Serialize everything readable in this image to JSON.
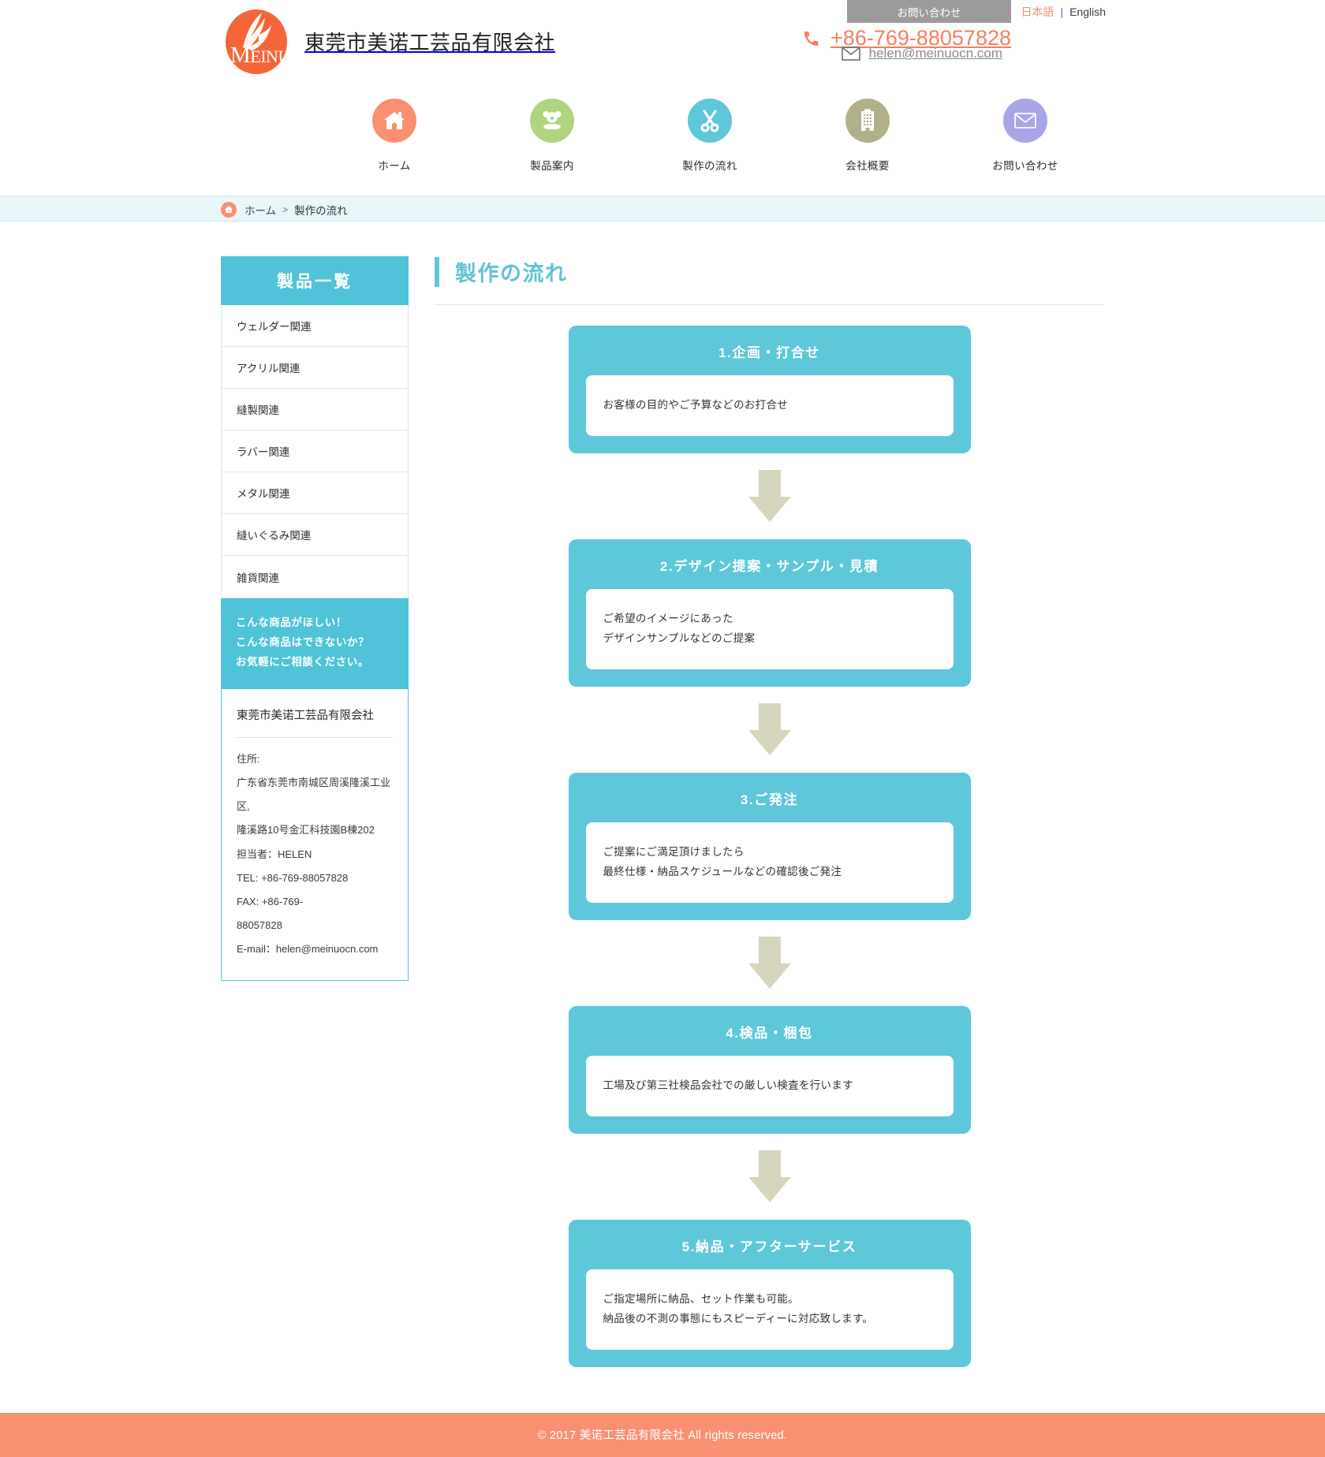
{
  "colors": {
    "accent_cyan": "#5ec8da",
    "brand_orange": "#f4663a",
    "footer_orange": "#fa9072",
    "nav_home": "#fa8f72",
    "nav_products": "#aed47e",
    "nav_flow": "#5ec8da",
    "nav_company": "#b2b089",
    "nav_contact": "#a9a6e8",
    "arrow_khaki": "#d6d6bd",
    "breadcrumb_bg": "#e8f6f9"
  },
  "header": {
    "logo_text_big": "M",
    "logo_text_rest": "EINUO",
    "company_name": "東莞市美诺工芸品有限会社",
    "contact_button": "お問い合わせ",
    "lang_ja": "日本語",
    "lang_sep": "|",
    "lang_en": "English",
    "phone": "+86-769-88057828",
    "email": "helen@meinuocn.com"
  },
  "mainnav": [
    {
      "label": "ホーム",
      "icon": "home-icon",
      "color": "#fa8f72"
    },
    {
      "label": "製品案内",
      "icon": "teddy-bear-icon",
      "color": "#aed47e"
    },
    {
      "label": "製作の流れ",
      "icon": "scissors-icon",
      "color": "#5ec8da"
    },
    {
      "label": "会社概要",
      "icon": "building-icon",
      "color": "#b2b089"
    },
    {
      "label": "お問い合わせ",
      "icon": "envelope-icon",
      "color": "#a9a6e8"
    }
  ],
  "breadcrumb": {
    "home": "ホーム",
    "separator": ">",
    "current": "製作の流れ"
  },
  "sidebar": {
    "heading": "製品一覧",
    "items": [
      {
        "label": "ウェルダー関連"
      },
      {
        "label": "アクリル関連"
      },
      {
        "label": "縫製関連"
      },
      {
        "label": "ラバー関連"
      },
      {
        "label": "メタル関連"
      },
      {
        "label": "縫いぐるみ関連"
      },
      {
        "label": "雑貨関連"
      }
    ],
    "cta_lines": [
      "こんな商品がほしい！",
      "こんな商品はできないか？",
      "お気軽にご相談ください。"
    ],
    "info": {
      "company": "東莞市美诺工芸品有限会社",
      "lines": [
        "住所:",
        "广东省东莞市南城区周溪隆溪工业区,",
        "隆溪路10号金汇科技園B棟202",
        "担当者：HELEN",
        "TEL:  +86-769-88057828",
        "FAX: +86-769-",
        "88057828",
        "E-mail：helen@meinuocn.com"
      ]
    }
  },
  "main": {
    "page_title": "製作の流れ",
    "steps": [
      {
        "title": "1.企画・打合せ",
        "lines": [
          "お客様の目的やご予算などのお打合せ"
        ]
      },
      {
        "title": "2.デザイン提案・サンプル・見積",
        "lines": [
          "ご希望のイメージにあった",
          "デザインサンプルなどのご提案"
        ]
      },
      {
        "title": "3.ご発注",
        "lines": [
          "ご提案にご満足頂けましたら",
          "最終仕様・納品スケジュールなどの確認後ご発注"
        ]
      },
      {
        "title": "4.検品・梱包",
        "lines": [
          "工場及び第三社検品会社での厳しい検査を行います"
        ]
      },
      {
        "title": "5.納品・アフターサービス",
        "lines": [
          "ご指定場所に納品、セット作業も可能。",
          "納品後の不測の事態にもスピーディーに対応致します。"
        ]
      }
    ]
  },
  "footer": {
    "copyright": "© 2017 美诺工芸品有限会社 All rights reserved."
  }
}
